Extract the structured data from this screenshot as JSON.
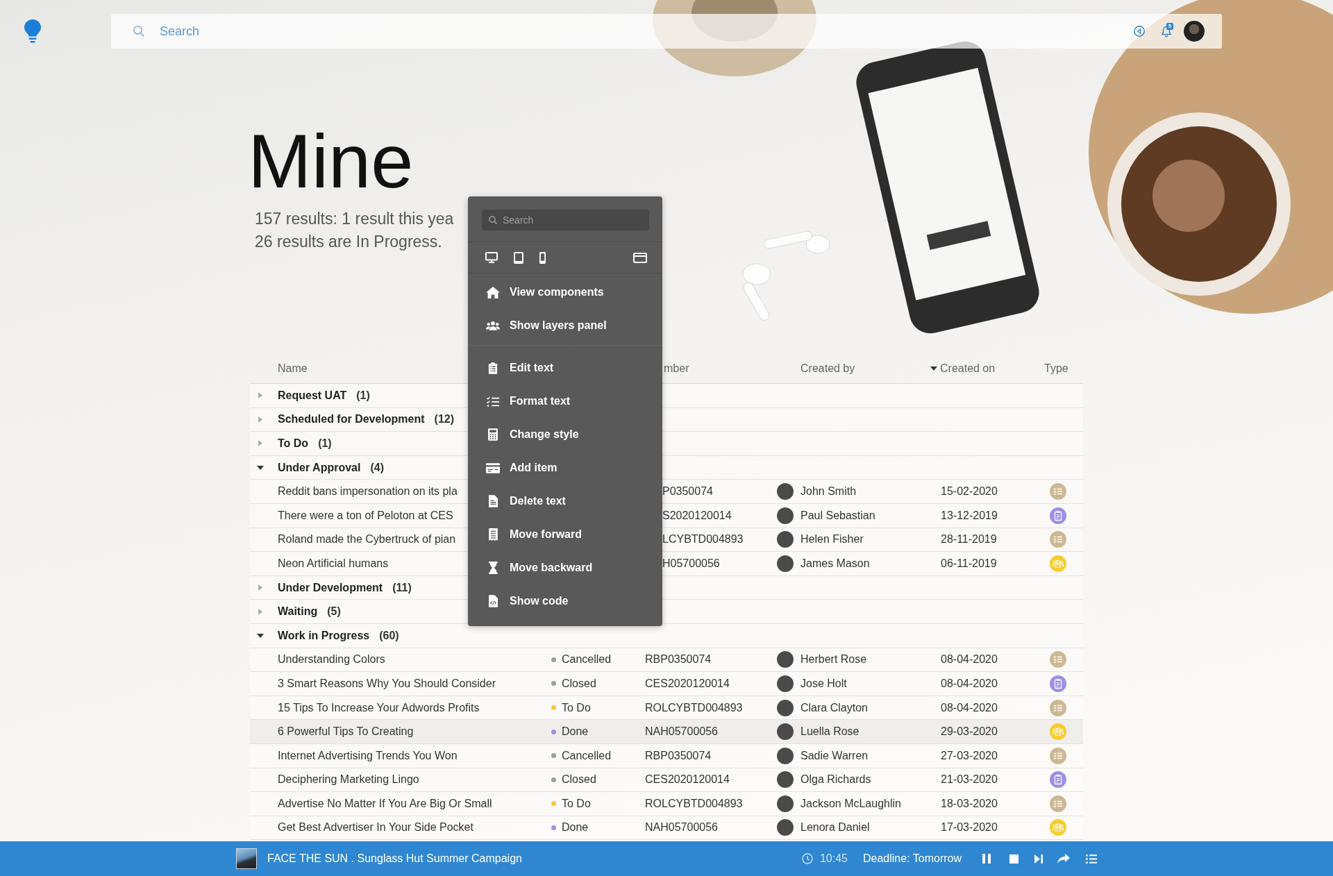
{
  "top_bar": {
    "search": {
      "placeholder": "Search"
    },
    "notifications_badge": "5"
  },
  "page": {
    "title": "Mine",
    "summary": [
      "157 results: 1 result this yea",
      "26 results are In Progress."
    ]
  },
  "context_menu": {
    "search": {
      "placeholder": "Search"
    },
    "sections": [
      {
        "items": [
          {
            "label": "View components"
          },
          {
            "label": "Show layers panel"
          }
        ]
      },
      {
        "items": [
          {
            "label": "Edit text"
          },
          {
            "label": "Format text"
          },
          {
            "label": "Change style"
          },
          {
            "label": "Add item"
          },
          {
            "label": "Delete text"
          },
          {
            "label": "Move forward"
          },
          {
            "label": "Move backward"
          },
          {
            "label": "Show code"
          }
        ]
      }
    ]
  },
  "table": {
    "columns": [
      {
        "label": "Name",
        "sorted": false
      },
      {
        "label": "mber",
        "sorted": false
      },
      {
        "label": "Created by",
        "sorted": false
      },
      {
        "label": "Created on",
        "sorted": true
      },
      {
        "label": "Type",
        "sorted": false
      }
    ],
    "groups": [
      {
        "label": "Request UAT",
        "count": "(1)",
        "expanded": false
      },
      {
        "label": "Scheduled for Development",
        "count": "(12)",
        "expanded": false
      },
      {
        "label": "To Do",
        "count": "(1)",
        "expanded": false
      },
      {
        "label": "Under Approval",
        "count": "(4)",
        "expanded": true,
        "rows": [
          {
            "name": "Reddit bans impersonation on its pla",
            "number": "P0350074",
            "created_by": "John Smith",
            "created_on": "15-02-2020",
            "type": {
              "kind": "checklist",
              "color": "#cbb994"
            },
            "selected": false
          },
          {
            "name": "There were a ton of Peloton at CES",
            "number": "S2020120014",
            "created_by": "Paul Sebastian",
            "created_on": "13-12-2019",
            "type": {
              "kind": "clipboard",
              "color": "#9d8fe6"
            },
            "selected": false
          },
          {
            "name": "Roland made the Cybertruck of pian",
            "number": "LCYBTD004893",
            "created_by": "Helen Fisher",
            "created_on": "28-11-2019",
            "type": {
              "kind": "checklist",
              "color": "#cbb994"
            },
            "selected": false
          },
          {
            "name": "Neon Artificial humans",
            "number": "H05700056",
            "created_by": "James Mason",
            "created_on": "06-11-2019",
            "type": {
              "kind": "group",
              "color": "#f7cd2e"
            },
            "selected": false
          }
        ]
      },
      {
        "label": "Under Development",
        "count": "(11)",
        "expanded": false
      },
      {
        "label": "Waiting",
        "count": "(5)",
        "expanded": false
      },
      {
        "label": "Work in Progress",
        "count": "(60)",
        "expanded": true,
        "rows": [
          {
            "name": "Understanding Colors",
            "status": {
              "label": "Cancelled",
              "color": "#9e9e9e"
            },
            "number": "RBP0350074",
            "created_by": "Herbert Rose",
            "created_on": "08-04-2020",
            "type": {
              "kind": "checklist",
              "color": "#cbb994"
            },
            "selected": false
          },
          {
            "name": "3 Smart Reasons Why You Should Consider",
            "status": {
              "label": "Closed",
              "color": "#9e9e9e"
            },
            "number": "CES2020120014",
            "created_by": "Jose Holt",
            "created_on": "08-04-2020",
            "type": {
              "kind": "clipboard",
              "color": "#9d8fe6"
            },
            "selected": false
          },
          {
            "name": "15 Tips To Increase Your Adwords Profits",
            "status": {
              "label": "To Do",
              "color": "#f5c842"
            },
            "number": "ROLCYBTD004893",
            "created_by": "Clara Clayton",
            "created_on": "08-04-2020",
            "type": {
              "kind": "checklist",
              "color": "#cbb994"
            },
            "selected": false
          },
          {
            "name": "6 Powerful Tips To Creating",
            "status": {
              "label": "Done",
              "color": "#9d8fe6"
            },
            "number": "NAH05700056",
            "created_by": "Luella Rose",
            "created_on": "29-03-2020",
            "type": {
              "kind": "group",
              "color": "#f7cd2e"
            },
            "selected": true
          },
          {
            "name": "Internet Advertising Trends You Won",
            "status": {
              "label": "Cancelled",
              "color": "#9e9e9e"
            },
            "number": "RBP0350074",
            "created_by": "Sadie Warren",
            "created_on": "27-03-2020",
            "type": {
              "kind": "checklist",
              "color": "#cbb994"
            },
            "selected": false
          },
          {
            "name": "Deciphering Marketing Lingo",
            "status": {
              "label": "Closed",
              "color": "#9e9e9e"
            },
            "number": "CES2020120014",
            "created_by": "Olga Richards",
            "created_on": "21-03-2020",
            "type": {
              "kind": "clipboard",
              "color": "#9d8fe6"
            },
            "selected": false
          },
          {
            "name": "Advertise No Matter If You Are Big Or Small",
            "status": {
              "label": "To Do",
              "color": "#f5c842"
            },
            "number": "ROLCYBTD004893",
            "created_by": "Jackson McLaughlin",
            "created_on": "18-03-2020",
            "type": {
              "kind": "checklist",
              "color": "#cbb994"
            },
            "selected": false
          },
          {
            "name": "Get Best Advertiser In Your Side Pocket",
            "status": {
              "label": "Done",
              "color": "#9d8fe6"
            },
            "number": "NAH05700056",
            "created_by": "Lenora Daniel",
            "created_on": "17-03-2020",
            "type": {
              "kind": "group",
              "color": "#f7cd2e"
            },
            "selected": false
          }
        ]
      }
    ]
  },
  "player_bar": {
    "title": "FACE THE SUN . Sunglass Hut Summer Campaign",
    "time": "10:45",
    "deadline": "Deadline: Tomorrow"
  }
}
